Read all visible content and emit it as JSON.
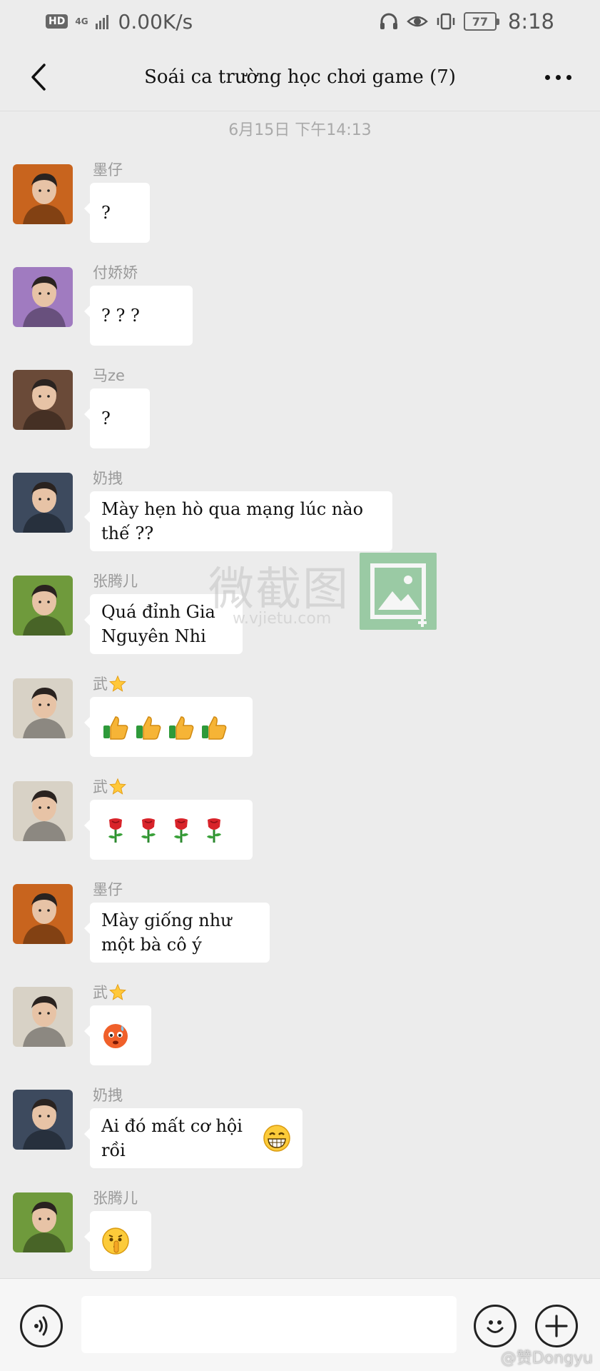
{
  "status_bar": {
    "hd": "HD",
    "network": "4G",
    "speed": "0.00K/s",
    "battery": "77",
    "time": "8:18",
    "icons": [
      "headphones-icon",
      "eye-icon",
      "vibrate-icon",
      "battery-icon"
    ]
  },
  "header": {
    "title": "Soái ca trường học chơi game (7)",
    "back_icon": "chevron-left-icon",
    "more_icon": "more-dots-icon"
  },
  "timestamp": "6月15日 下午14:13",
  "messages": [
    {
      "sender": "墨仔",
      "text": "?",
      "avatar_color": "#c8641e"
    },
    {
      "sender": "付娇娇",
      "text": "? ? ?",
      "avatar_color": "#a07bc0"
    },
    {
      "sender": "马ze",
      "text": "?",
      "avatar_color": "#6a4a38"
    },
    {
      "sender": "奶拽",
      "text": "Mày hẹn hò qua mạng lúc nào thế ??",
      "avatar_color": "#3d4a5e"
    },
    {
      "sender": "张腾儿",
      "text": "Quá đỉnh Gia\nNguyên Nhi",
      "avatar_color": "#6f9a3c"
    },
    {
      "sender": "武",
      "sender_emoji": "star",
      "emoji": "thumbs-up",
      "emoji_count": 4,
      "avatar_color": "#d8d2c6"
    },
    {
      "sender": "武",
      "sender_emoji": "star",
      "emoji": "rose",
      "emoji_count": 4,
      "avatar_color": "#d8d2c6"
    },
    {
      "sender": "墨仔",
      "text": "Mày giống như\nmột bà cô ý",
      "avatar_color": "#c8641e"
    },
    {
      "sender": "武",
      "sender_emoji": "star",
      "emoji": "anxious-face",
      "emoji_count": 1,
      "avatar_color": "#d8d2c6"
    },
    {
      "sender": "奶拽",
      "text": "Ai đó mất cơ hội rồi",
      "emoji": "grin",
      "avatar_color": "#3d4a5e"
    },
    {
      "sender": "张腾儿",
      "emoji": "shush-face",
      "emoji_count": 1,
      "avatar_color": "#6f9a3c"
    }
  ],
  "watermark": {
    "text": "微截图",
    "url": "w.vjietu.com"
  },
  "input": {
    "placeholder": "",
    "value": ""
  },
  "bottom_icons": [
    "voice-icon",
    "emoji-face-icon",
    "plus-icon"
  ],
  "credit": "@赞Dongyu"
}
